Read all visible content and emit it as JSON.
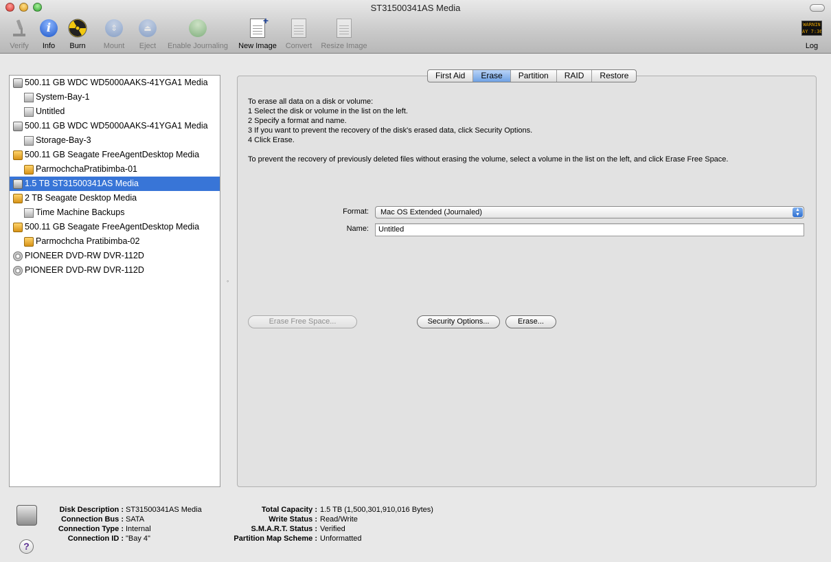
{
  "window": {
    "title": "ST31500341AS Media"
  },
  "toolbar": {
    "verify": "Verify",
    "info": "Info",
    "burn": "Burn",
    "mount": "Mount",
    "eject": "Eject",
    "enable_journaling": "Enable Journaling",
    "new_image": "New Image",
    "convert": "Convert",
    "resize_image": "Resize Image",
    "log": "Log",
    "log_icon_text": "WARNIN\nAY 7:36"
  },
  "sidebar": {
    "items": [
      {
        "label": "500.11 GB WDC WD5000AAKS-41YGA1 Media",
        "icon": "hard-disk-icon"
      },
      {
        "label": "System-Bay-1",
        "icon": "volume-icon"
      },
      {
        "label": "Untitled",
        "icon": "volume-icon"
      },
      {
        "label": "500.11 GB WDC WD5000AAKS-41YGA1 Media",
        "icon": "hard-disk-icon"
      },
      {
        "label": "Storage-Bay-3",
        "icon": "volume-icon"
      },
      {
        "label": "500.11 GB Seagate FreeAgentDesktop Media",
        "icon": "external-disk-icon"
      },
      {
        "label": "ParmochchaPratibimba-01",
        "icon": "external-volume-icon"
      },
      {
        "label": "1.5 TB ST31500341AS Media",
        "icon": "hard-disk-icon",
        "selected": true
      },
      {
        "label": "2 TB Seagate Desktop Media",
        "icon": "external-disk-icon"
      },
      {
        "label": "Time Machine Backups",
        "icon": "external-volume-icon"
      },
      {
        "label": "500.11 GB Seagate FreeAgentDesktop Media",
        "icon": "external-disk-icon"
      },
      {
        "label": "Parmochcha Pratibimba-02",
        "icon": "external-volume-icon"
      },
      {
        "label": "PIONEER DVD-RW DVR-112D",
        "icon": "dvd-drive-icon"
      },
      {
        "label": "PIONEER DVD-RW DVR-112D",
        "icon": "dvd-drive-icon"
      }
    ]
  },
  "tabs": [
    "First Aid",
    "Erase",
    "Partition",
    "RAID",
    "Restore"
  ],
  "active_tab": "Erase",
  "erase": {
    "instructions": [
      "To erase all data on a disk or volume:",
      "1 Select the disk or volume in the list on the left.",
      "2 Specify a format and name.",
      "3 If you want to prevent the recovery of the disk's erased data, click Security Options.",
      "4 Click Erase."
    ],
    "free_space_note": "To prevent the recovery of previously deleted files without erasing the volume, select a volume in the list on the left, and click Erase Free Space.",
    "format_label": "Format:",
    "format_value": "Mac OS Extended (Journaled)",
    "name_label": "Name:",
    "name_value": "Untitled",
    "erase_free_space_button": "Erase Free Space...",
    "security_options_button": "Security Options...",
    "erase_button": "Erase..."
  },
  "info": {
    "disk_description_label": "Disk Description :",
    "disk_description": "ST31500341AS Media",
    "connection_bus_label": "Connection Bus :",
    "connection_bus": "SATA",
    "connection_type_label": "Connection Type :",
    "connection_type": "Internal",
    "connection_id_label": "Connection ID :",
    "connection_id": "\"Bay 4\"",
    "total_capacity_label": "Total Capacity :",
    "total_capacity": "1.5 TB (1,500,301,910,016 Bytes)",
    "write_status_label": "Write Status :",
    "write_status": "Read/Write",
    "smart_status_label": "S.M.A.R.T. Status :",
    "smart_status": "Verified",
    "partition_map_label": "Partition Map Scheme :",
    "partition_map": "Unformatted",
    "help": "?"
  },
  "colors": {
    "selection": "#3875d7",
    "close": "#e0443e",
    "minimize": "#dea123",
    "zoom": "#1aab29"
  }
}
